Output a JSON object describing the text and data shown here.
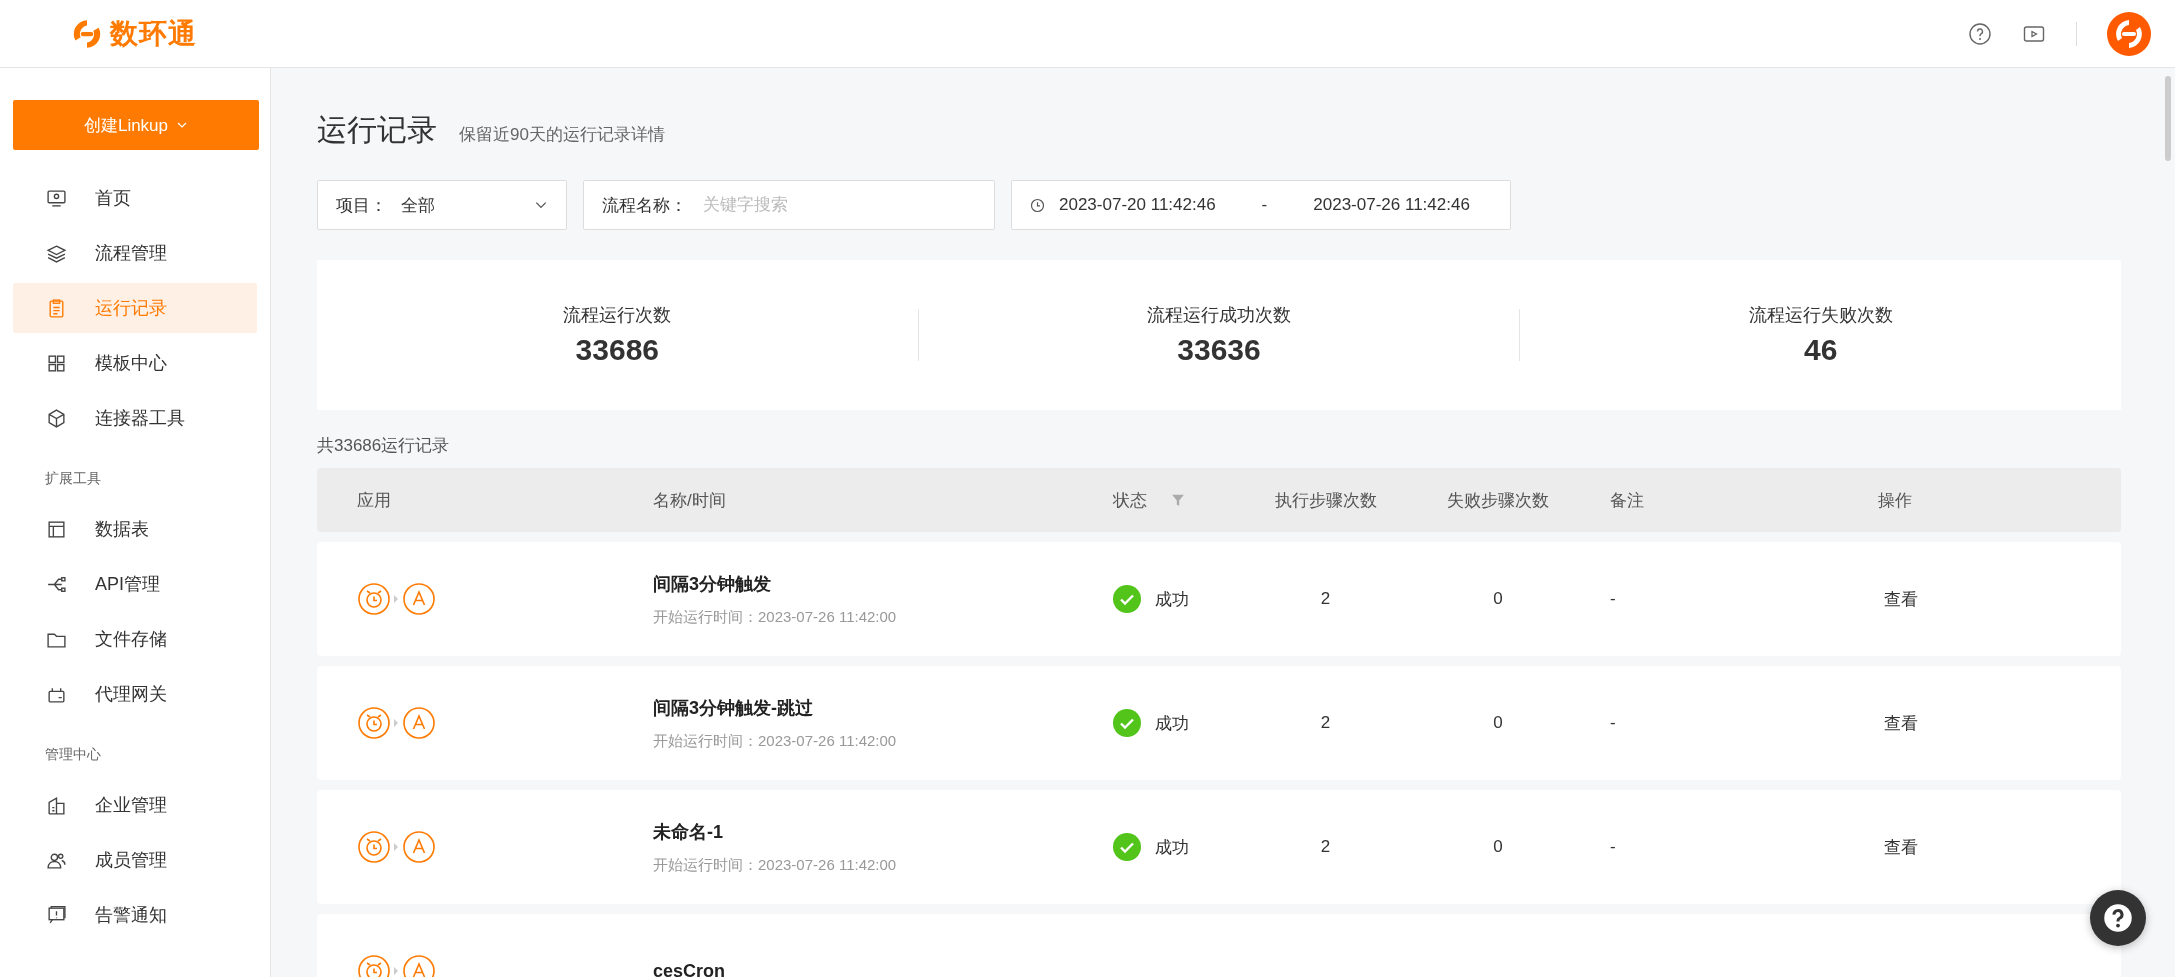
{
  "header": {
    "brand": "数环通"
  },
  "sidebar": {
    "create_button": "创建Linkup",
    "sections": [
      {
        "items": [
          {
            "label": "首页",
            "selected": false
          },
          {
            "label": "流程管理",
            "selected": false
          },
          {
            "label": "运行记录",
            "selected": true
          },
          {
            "label": "模板中心",
            "selected": false
          },
          {
            "label": "连接器工具",
            "selected": false
          }
        ]
      },
      {
        "title": "扩展工具",
        "items": [
          {
            "label": "数据表",
            "selected": false
          },
          {
            "label": "API管理",
            "selected": false
          },
          {
            "label": "文件存储",
            "selected": false
          },
          {
            "label": "代理网关",
            "selected": false
          }
        ]
      },
      {
        "title": "管理中心",
        "items": [
          {
            "label": "企业管理",
            "selected": false
          },
          {
            "label": "成员管理",
            "selected": false
          },
          {
            "label": "告警通知",
            "selected": false
          }
        ]
      }
    ]
  },
  "page": {
    "title": "运行记录",
    "subtitle": "保留近90天的运行记录详情"
  },
  "filters": {
    "project": {
      "label": "项目：",
      "value": "全部"
    },
    "flow_name": {
      "label": "流程名称：",
      "placeholder": "关键字搜索"
    },
    "date_range": {
      "start": "2023-07-20 11:42:46",
      "separator": "-",
      "end": "2023-07-26 11:42:46"
    }
  },
  "stats": [
    {
      "label": "流程运行次数",
      "value": "33686"
    },
    {
      "label": "流程运行成功次数",
      "value": "33636"
    },
    {
      "label": "流程运行失败次数",
      "value": "46"
    }
  ],
  "table": {
    "total": "共33686运行记录",
    "columns": [
      "应用",
      "名称/时间",
      "状态",
      "执行步骤次数",
      "失败步骤次数",
      "备注",
      "操作"
    ],
    "rows": [
      {
        "name": "间隔3分钟触发",
        "start": "开始运行时间：2023-07-26 11:42:00",
        "status": {
          "kind": "success",
          "text": "成功"
        },
        "exec_steps": "2",
        "fail_steps": "0",
        "note": "-",
        "action": "查看"
      },
      {
        "name": "间隔3分钟触发-跳过",
        "start": "开始运行时间：2023-07-26 11:42:00",
        "status": {
          "kind": "success",
          "text": "成功"
        },
        "exec_steps": "2",
        "fail_steps": "0",
        "note": "-",
        "action": "查看"
      },
      {
        "name": "未命名-1",
        "start": "开始运行时间：2023-07-26 11:42:00",
        "status": {
          "kind": "success",
          "text": "成功"
        },
        "exec_steps": "2",
        "fail_steps": "0",
        "note": "-",
        "action": "查看"
      },
      {
        "name": "cesCron"
      }
    ]
  }
}
